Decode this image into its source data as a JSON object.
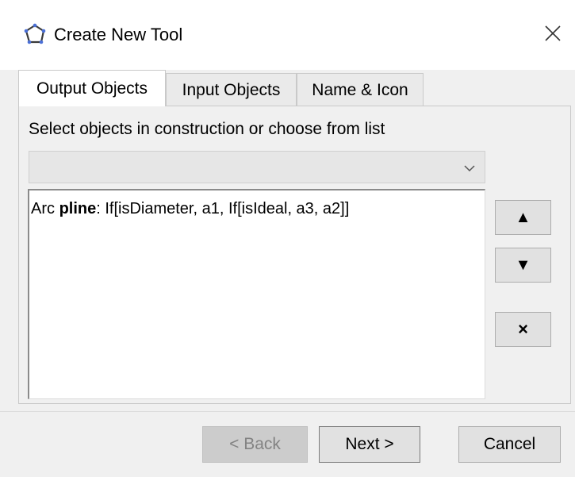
{
  "window": {
    "title": "Create New Tool",
    "icon": "tool-polygon-icon",
    "close_icon": "close-icon"
  },
  "tabs": [
    {
      "label": "Output Objects",
      "selected": true
    },
    {
      "label": "Input Objects",
      "selected": false
    },
    {
      "label": "Name & Icon",
      "selected": false
    }
  ],
  "output_panel": {
    "instruction": "Select objects in construction or choose from list",
    "dropdown_value": "",
    "list_items": [
      {
        "type_prefix": "Arc ",
        "name": "pline",
        "definition": ": If[isDiameter, a1, If[isIdeal, a3, a2]]"
      }
    ],
    "move_up_label": "▲",
    "move_down_label": "▼",
    "remove_label": "×"
  },
  "footer": {
    "back_label": "< Back",
    "back_enabled": false,
    "next_label": "Next >",
    "cancel_label": "Cancel"
  }
}
